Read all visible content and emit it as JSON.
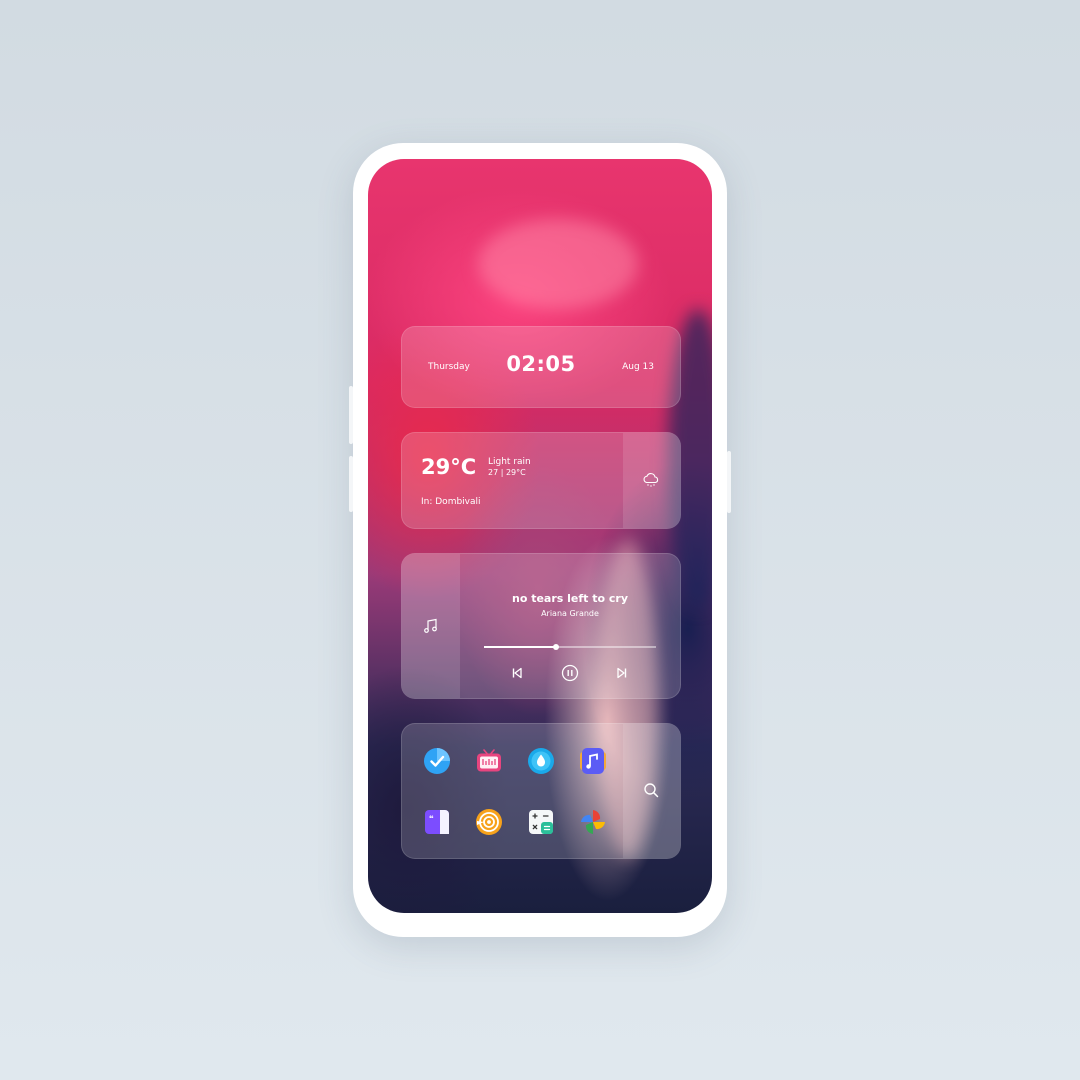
{
  "clock": {
    "day": "Thursday",
    "time": "02:05",
    "date": "Aug 13"
  },
  "weather": {
    "temperature": "29°C",
    "condition": "Light rain",
    "range": "27 | 29°C",
    "location": "In: Dombivali",
    "icon": "cloud-rain-icon"
  },
  "music": {
    "title": "no tears left to cry",
    "artist": "Ariana Grande",
    "progress": 0.42,
    "icons": [
      "music-note-icon",
      "previous-icon",
      "pause-icon",
      "next-icon"
    ]
  },
  "apps": {
    "row1": [
      "tasks-app-icon",
      "bilibili-app-icon",
      "water-drop-app-icon",
      "music-app-icon"
    ],
    "row2": [
      "notes-app-icon",
      "podcast-app-icon",
      "calculator-app-icon",
      "pinwheel-app-icon"
    ],
    "search_icon": "search-icon",
    "colors": {
      "tasks": "#2fa3f5",
      "bilibili": "#e8457f",
      "water": "#1aa9ea",
      "music": "#5b5cf5",
      "notes": "#7c4dff",
      "podcast": "#f7a21b",
      "calculator": "#2bbf9a"
    }
  }
}
